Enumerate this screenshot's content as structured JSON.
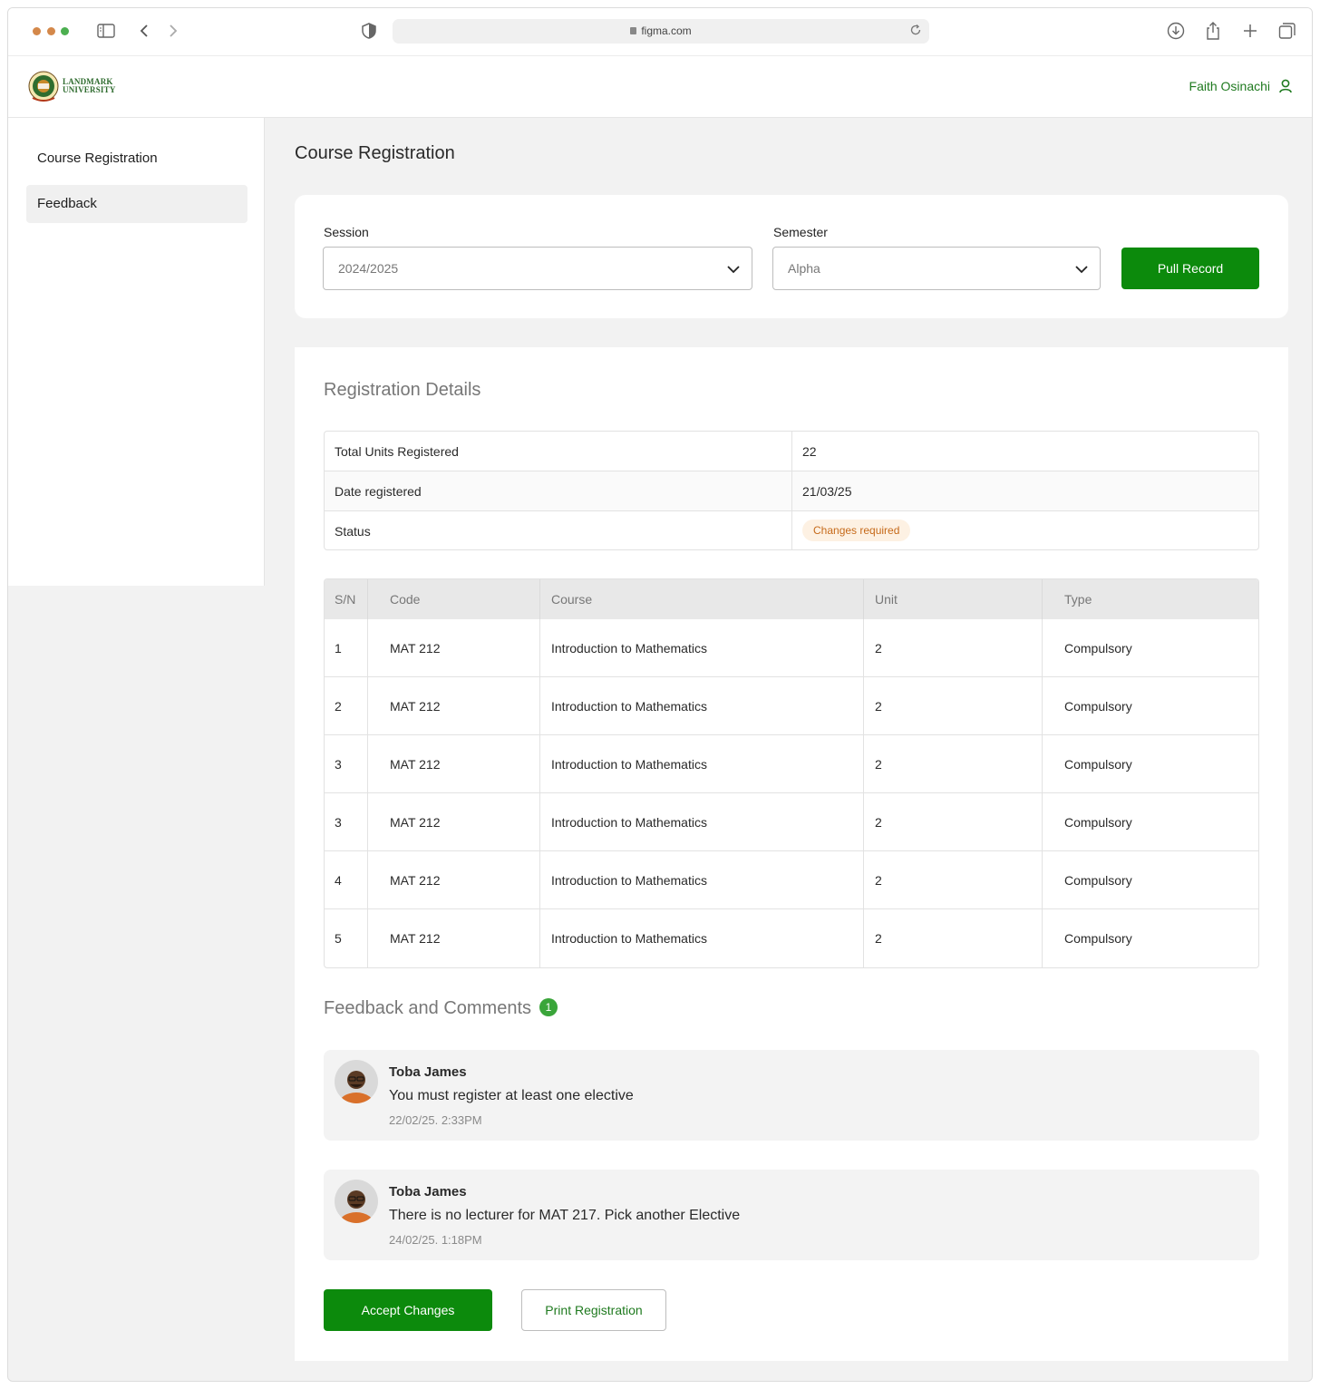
{
  "browser": {
    "url": "figma.com"
  },
  "header": {
    "brand_line1": "LANDMARK",
    "brand_line2": "UNIVERSITY",
    "user_name": "Faith Osinachi"
  },
  "sidebar": {
    "items": [
      {
        "label": "Course Registration"
      },
      {
        "label": "Feedback"
      }
    ]
  },
  "main": {
    "title": "Course Registration",
    "filters": {
      "session_label": "Session",
      "session_value": "2024/2025",
      "semester_label": "Semester",
      "semester_value": "Alpha",
      "pull_button": "Pull Record"
    },
    "details": {
      "title": "Registration Details",
      "rows": [
        {
          "key": "Total Units Registered",
          "value": "22"
        },
        {
          "key": "Date registered",
          "value": "21/03/25"
        },
        {
          "key": "Status",
          "value": "Changes required"
        }
      ]
    },
    "courses": {
      "headers": [
        "S/N",
        "Code",
        "Course",
        "Unit",
        "Type"
      ],
      "rows": [
        [
          "1",
          "MAT 212",
          "Introduction to Mathematics",
          "2",
          "Compulsory"
        ],
        [
          "2",
          "MAT 212",
          "Introduction to Mathematics",
          "2",
          "Compulsory"
        ],
        [
          "3",
          "MAT 212",
          "Introduction to Mathematics",
          "2",
          "Compulsory"
        ],
        [
          "3",
          "MAT 212",
          "Introduction to Mathematics",
          "2",
          "Compulsory"
        ],
        [
          "4",
          "MAT 212",
          "Introduction to Mathematics",
          "2",
          "Compulsory"
        ],
        [
          "5",
          "MAT 212",
          "Introduction to Mathematics",
          "2",
          "Compulsory"
        ]
      ]
    },
    "feedback": {
      "title": "Feedback and Comments",
      "count": "1",
      "comments": [
        {
          "author": "Toba James",
          "message": "You must register at least one elective",
          "time": "22/02/25. 2:33PM"
        },
        {
          "author": "Toba James",
          "message": "There is no lecturer for MAT 217. Pick another Elective",
          "time": "24/02/25. 1:18PM"
        }
      ]
    },
    "actions": {
      "accept": "Accept Changes",
      "print": "Print Registration"
    }
  },
  "colors": {
    "accent": "#0c8a0c",
    "status_bg": "#fdf1e3",
    "status_text": "#c66a1a"
  }
}
